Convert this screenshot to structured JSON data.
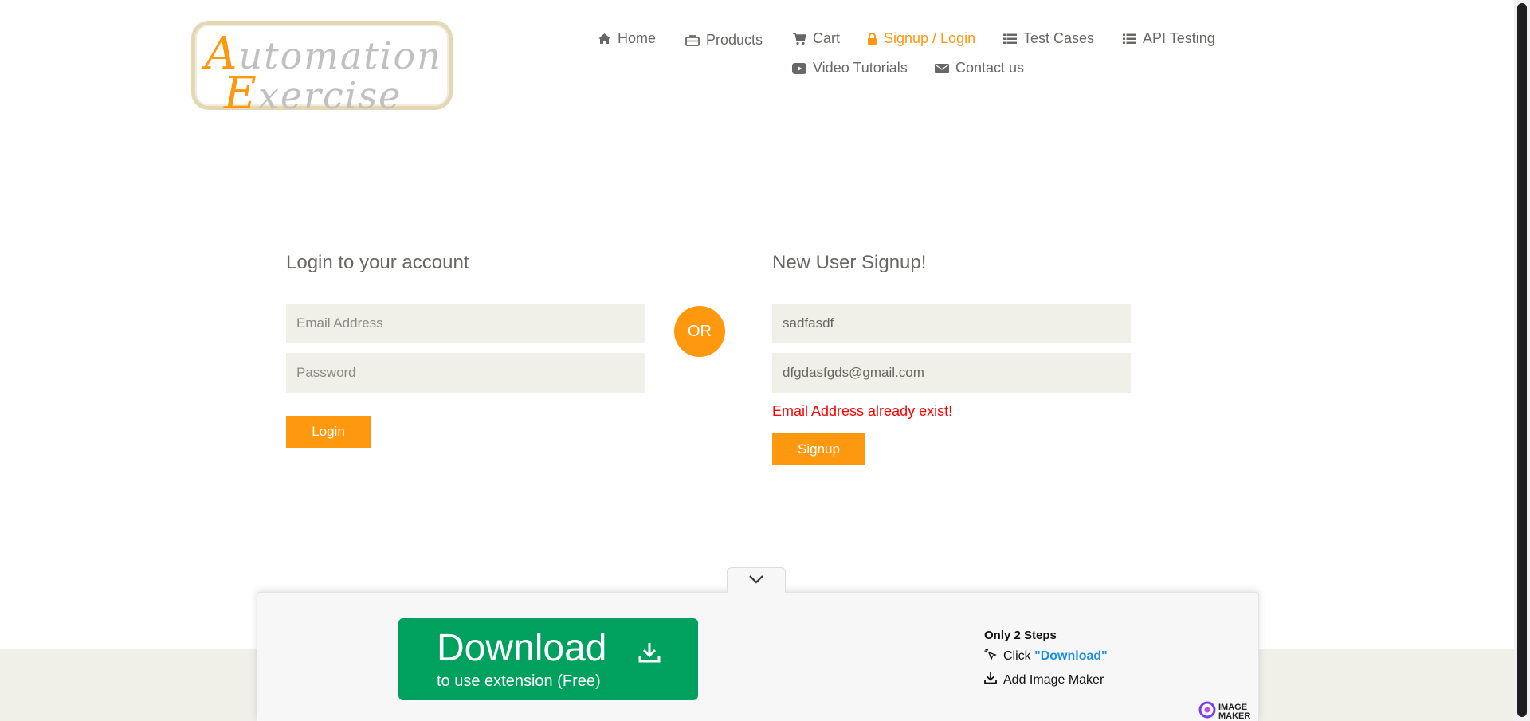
{
  "brand": {
    "logo_line1_cap": "A",
    "logo_line1_rest": "utomation",
    "logo_line2_cap": "E",
    "logo_line2_rest": "xercise"
  },
  "nav": {
    "items": [
      {
        "label": "Home",
        "icon": "home-icon"
      },
      {
        "label": "Products",
        "icon": "briefcase-icon"
      },
      {
        "label": "Cart",
        "icon": "cart-icon"
      },
      {
        "label": "Signup / Login",
        "icon": "lock-icon",
        "active": true
      },
      {
        "label": "Test Cases",
        "icon": "list-icon"
      },
      {
        "label": "API Testing",
        "icon": "list-icon"
      },
      {
        "label": "Video Tutorials",
        "icon": "youtube-icon"
      },
      {
        "label": "Contact us",
        "icon": "envelope-icon"
      }
    ]
  },
  "login": {
    "title": "Login to your account",
    "email_placeholder": "Email Address",
    "password_placeholder": "Password",
    "button_label": "Login"
  },
  "divider": {
    "label": "OR"
  },
  "signup": {
    "title": "New User Signup!",
    "name_value": "sadfasdf",
    "email_value": "dfgdasfgds@gmail.com",
    "error_message": "Email Address already exist!",
    "button_label": "Signup"
  },
  "extension_banner": {
    "download_label": "Download",
    "download_sub": "to use extension (Free)",
    "steps_title": "Only 2 Steps",
    "step1_prefix": "Click",
    "step1_highlight": "\"Download\"",
    "step2": "Add Image Maker",
    "brand_line1": "IMAGE",
    "brand_line2": "MAKER"
  },
  "colors": {
    "accent": "#fe980f",
    "field_bg": "#f0f0e9",
    "error": "#ff0000",
    "download_green": "#00a15e",
    "text": "#696763"
  }
}
